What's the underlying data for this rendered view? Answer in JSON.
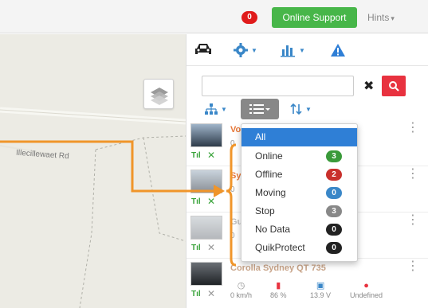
{
  "header": {
    "notification_count": "0",
    "support_label": "Online Support",
    "hints_label": "Hints",
    "hints_caret": "▾",
    "colors": {
      "support": "#47b649",
      "badge": "#e01b1b"
    }
  },
  "map": {
    "road_label": "Illecillewaet Rd",
    "layers_icon": "layers-icon"
  },
  "panel": {
    "tabs": [
      {
        "icon": "car-icon"
      },
      {
        "icon": "gear-icon"
      },
      {
        "icon": "bar-chart-icon"
      },
      {
        "icon": "alert-icon"
      }
    ],
    "search": {
      "placeholder": "",
      "value": "",
      "clear_glyph": "✖"
    },
    "filters": [
      {
        "icon": "hierarchy-icon"
      },
      {
        "icon": "list-icon"
      },
      {
        "icon": "sort-icon"
      }
    ]
  },
  "vehicles": [
    {
      "name": "Vo",
      "sub": "0",
      "color": "#2e3b4a"
    },
    {
      "name": "Sy",
      "sub": "0",
      "color": "#8a8f96"
    },
    {
      "name": "Gu",
      "sub": "0",
      "color": "#b5b8bc"
    },
    {
      "name": "Corolla Sydney QT 735",
      "speed": "0 km/h",
      "fuel": "86 %",
      "battery": "13.9 V",
      "driver": "Undefined",
      "color": "#1f2226"
    }
  ],
  "dropdown": {
    "items": [
      {
        "label": "All",
        "count": "",
        "active": true,
        "color": ""
      },
      {
        "label": "Online",
        "count": "3",
        "active": false,
        "color": "#3a9a3a"
      },
      {
        "label": "Offline",
        "count": "2",
        "active": false,
        "color": "#c9302c"
      },
      {
        "label": "Moving",
        "count": "0",
        "active": false,
        "color": "#3a87c8"
      },
      {
        "label": "Stop",
        "count": "3",
        "active": false,
        "color": "#888888"
      },
      {
        "label": "No Data",
        "count": "0",
        "active": false,
        "color": "#222222"
      },
      {
        "label": "QuikProtect",
        "count": "0",
        "active": false,
        "color": "#222222"
      }
    ]
  },
  "accent": {
    "orange": "#f0952a",
    "blue": "#3a87c8"
  }
}
